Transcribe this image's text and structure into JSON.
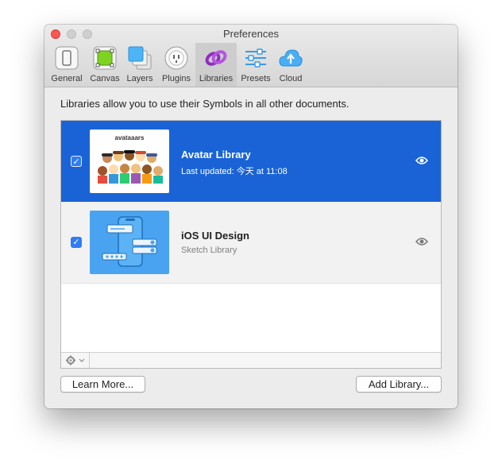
{
  "window": {
    "title": "Preferences"
  },
  "toolbar": {
    "items": [
      {
        "label": "General",
        "icon": "general-icon"
      },
      {
        "label": "Canvas",
        "icon": "canvas-icon"
      },
      {
        "label": "Layers",
        "icon": "layers-icon"
      },
      {
        "label": "Plugins",
        "icon": "plugins-icon"
      },
      {
        "label": "Libraries",
        "icon": "libraries-icon",
        "active": true
      },
      {
        "label": "Presets",
        "icon": "presets-icon"
      },
      {
        "label": "Cloud",
        "icon": "cloud-icon"
      }
    ]
  },
  "main": {
    "description": "Libraries allow you to use their Symbols in all other documents.",
    "libraries": [
      {
        "name": "Avatar Library",
        "subtitle": "Last updated: 今天 at 11:08",
        "checked": true,
        "selected": true,
        "thumbnail_title": "avataaars"
      },
      {
        "name": "iOS UI Design",
        "subtitle": "Sketch Library",
        "checked": true,
        "selected": false
      }
    ]
  },
  "footer": {
    "learn_more": "Learn More...",
    "add_library": "Add Library..."
  },
  "colors": {
    "selection": "#1a63d6",
    "accent": "#2f7cf6",
    "close": "#fc5753"
  }
}
